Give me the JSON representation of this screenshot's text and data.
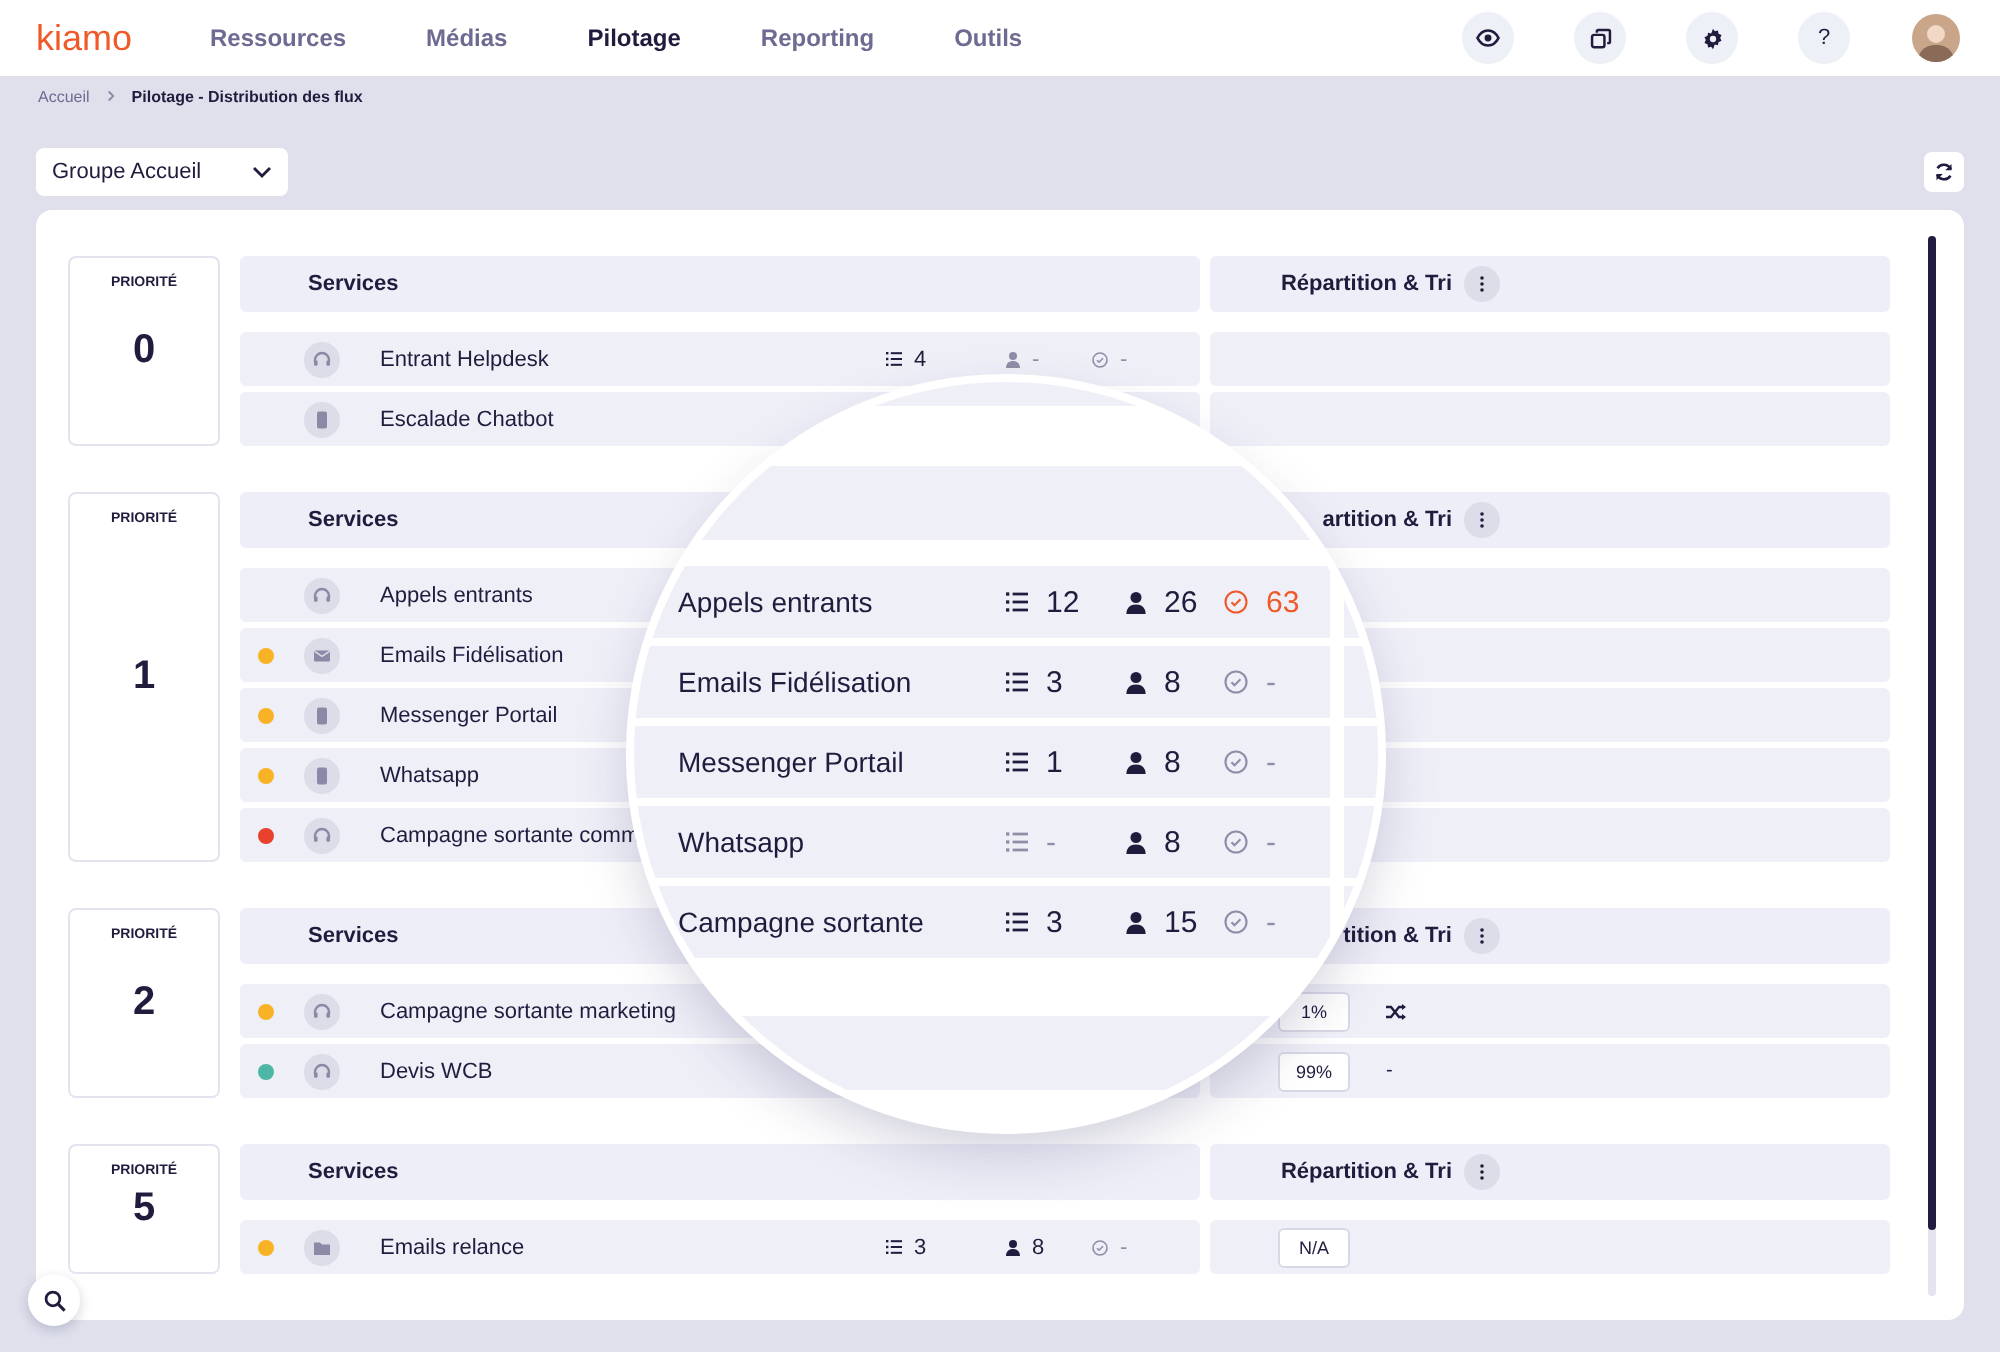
{
  "nav": {
    "logo": "kiamo",
    "tabs": [
      {
        "label": "Ressources",
        "selected": false
      },
      {
        "label": "Médias",
        "selected": false
      },
      {
        "label": "Pilotage",
        "selected": true
      },
      {
        "label": "Reporting",
        "selected": false
      },
      {
        "label": "Outils",
        "selected": false
      }
    ],
    "help_label": "?"
  },
  "breadcrumb": [
    "Accueil",
    "Pilotage - Distribution des flux"
  ],
  "group_select": {
    "value": "Groupe Accueil"
  },
  "priorities": [
    {
      "label": "PRIORITÉ",
      "number": "0",
      "services_header": "Services",
      "distribution_header": "Répartition & Tri",
      "rows": [
        {
          "kind": "headset",
          "name": "Entrant Helpdesk",
          "stats": [
            {
              "kind": "queue",
              "value": "4",
              "muted": false,
              "alert": false
            },
            {
              "kind": "agents",
              "value": "-",
              "muted": true,
              "alert": false
            },
            {
              "kind": "sla",
              "value": "-",
              "muted": true,
              "alert": false
            }
          ]
        },
        {
          "kind": "phone",
          "name": "Escalade Chatbot"
        }
      ]
    },
    {
      "label": "PRIORITÉ",
      "number": "1",
      "services_header": "Services",
      "distribution_header": "artition & Tri",
      "rows": [
        {
          "kind": "headset",
          "name": "Appels entrants"
        },
        {
          "color": "#f8b225",
          "kind": "mail",
          "name": "Emails Fidélisation"
        },
        {
          "color": "#f8b225",
          "kind": "phone",
          "name": "Messenger Portail"
        },
        {
          "color": "#f8b225",
          "kind": "phone",
          "name": "Whatsapp"
        },
        {
          "color": "#e8412c",
          "kind": "headset",
          "name": "Campagne sortante comm"
        }
      ]
    },
    {
      "label": "PRIORITÉ",
      "number": "2",
      "services_header": "Services",
      "distribution_header": "tition & Tri",
      "rows": [
        {
          "color": "#f8b225",
          "kind": "headset",
          "name": "Campagne sortante marketing",
          "distribution": {
            "share": "1%",
            "sort": {
              "kind": "shuffle"
            }
          }
        },
        {
          "color": "#4db6a4",
          "kind": "headset",
          "name": "Devis WCB",
          "distribution": {
            "share": "99%",
            "sort": {
              "kind": "text",
              "text": "-"
            }
          }
        }
      ]
    },
    {
      "label": "PRIORITÉ",
      "number": "5",
      "services_header": "Services",
      "distribution_header": "Répartition & Tri",
      "rows": [
        {
          "color": "#f8b225",
          "kind": "folder",
          "name": "Emails relance",
          "stats": [
            {
              "kind": "queue",
              "value": "3",
              "muted": false,
              "alert": false
            },
            {
              "kind": "agents",
              "value": "8",
              "muted": false,
              "alert": false
            },
            {
              "kind": "sla",
              "value": "-",
              "muted": true,
              "alert": false
            }
          ],
          "distribution": {
            "share": "N/A"
          }
        }
      ]
    }
  ],
  "magnifier": {
    "rows": [
      {
        "name": "Appels entrants",
        "stats": [
          {
            "kind": "queue",
            "value": "12",
            "muted": false,
            "alert": false
          },
          {
            "kind": "agents",
            "value": "26",
            "muted": false,
            "alert": false
          },
          {
            "kind": "sla",
            "value": "63",
            "muted": false,
            "alert": true
          }
        ]
      },
      {
        "name": "Emails Fidélisation",
        "stats": [
          {
            "kind": "queue",
            "value": "3",
            "muted": false,
            "alert": false
          },
          {
            "kind": "agents",
            "value": "8",
            "muted": false,
            "alert": false
          },
          {
            "kind": "sla",
            "value": "-",
            "muted": true,
            "alert": false
          }
        ]
      },
      {
        "name": "Messenger Portail",
        "stats": [
          {
            "kind": "queue",
            "value": "1",
            "muted": false,
            "alert": false
          },
          {
            "kind": "agents",
            "value": "8",
            "muted": false,
            "alert": false
          },
          {
            "kind": "sla",
            "value": "-",
            "muted": true,
            "alert": false
          }
        ]
      },
      {
        "name": "Whatsapp",
        "stats": [
          {
            "kind": "queue",
            "value": "-",
            "muted": true,
            "alert": false
          },
          {
            "kind": "agents",
            "value": "8",
            "muted": false,
            "alert": false
          },
          {
            "kind": "sla",
            "value": "-",
            "muted": true,
            "alert": false
          }
        ]
      },
      {
        "name": "Campagne sortante",
        "stats": [
          {
            "kind": "queue",
            "value": "3",
            "muted": false,
            "alert": false
          },
          {
            "kind": "agents",
            "value": "15",
            "muted": false,
            "alert": false
          },
          {
            "kind": "sla",
            "value": "-",
            "muted": true,
            "alert": false
          }
        ]
      }
    ]
  }
}
